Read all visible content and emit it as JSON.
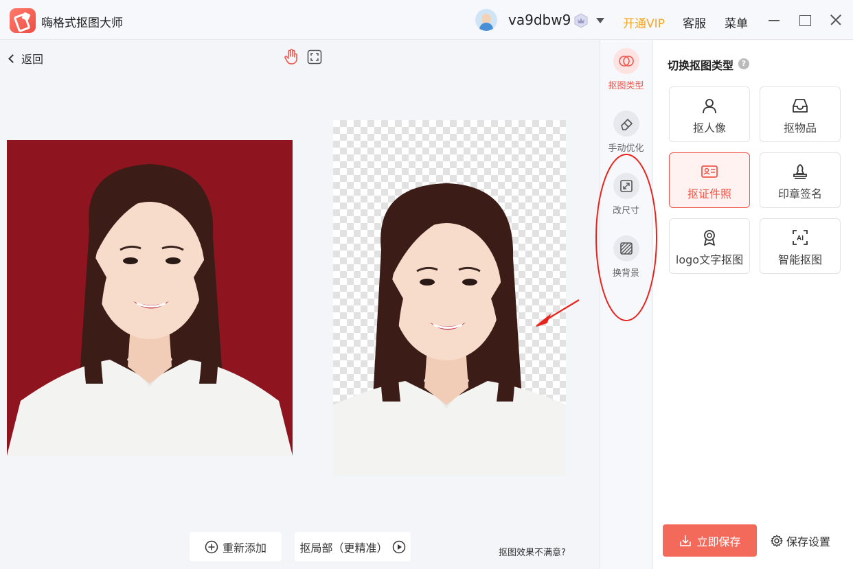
{
  "app": {
    "title": "嗨格式抠图大师"
  },
  "header": {
    "username": "va9dbw9",
    "open_vip": "开通VIP",
    "service": "客服",
    "menu": "菜单"
  },
  "toolbar": {
    "back_label": "返回"
  },
  "canvas": {
    "readd_label": "重新添加",
    "partial_label": "抠局部（更精准）",
    "unsatisfied_label": "抠图效果不满意?"
  },
  "tools": [
    {
      "label": "抠图类型",
      "icon": "cutout-type-icon",
      "active": true
    },
    {
      "label": "手动优化",
      "icon": "eraser-icon",
      "active": false
    },
    {
      "label": "改尺寸",
      "icon": "resize-icon",
      "active": false
    },
    {
      "label": "换背景",
      "icon": "background-icon",
      "active": false
    }
  ],
  "panel": {
    "title": "切换抠图类型",
    "types": [
      {
        "label": "抠人像",
        "icon": "person-icon",
        "active": false
      },
      {
        "label": "抠物品",
        "icon": "inbox-icon",
        "active": false
      },
      {
        "label": "抠证件照",
        "icon": "id-card-icon",
        "active": true
      },
      {
        "label": "印章签名",
        "icon": "stamp-icon",
        "active": false
      },
      {
        "label": "logo文字抠图",
        "icon": "badge-icon",
        "active": false
      },
      {
        "label": "智能抠图",
        "icon": "ai-icon",
        "active": false
      }
    ],
    "save_now": "立即保存",
    "save_settings": "保存设置"
  },
  "colors": {
    "accent": "#f1564a",
    "vip": "#f5a623",
    "photo_bg": "#8e1520",
    "annotation": "#e8231c"
  }
}
